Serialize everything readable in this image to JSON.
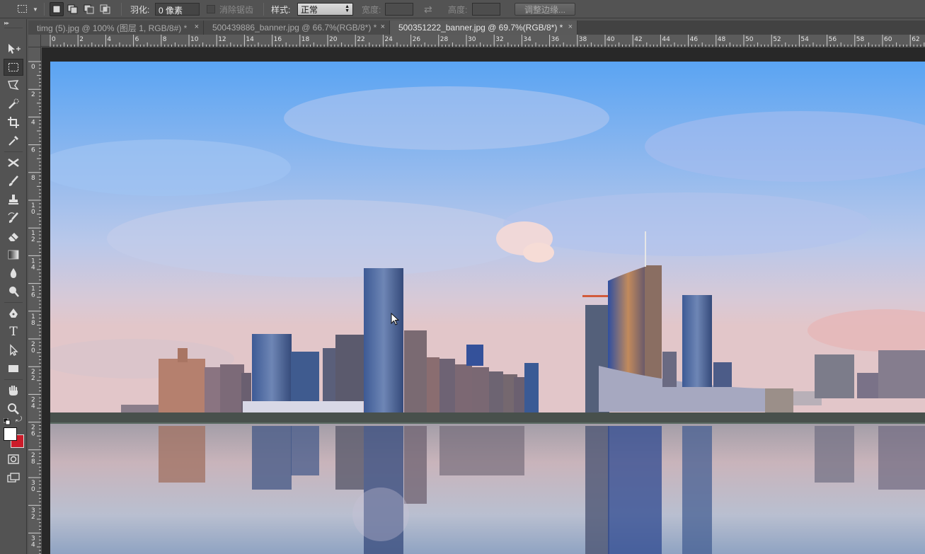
{
  "options_bar": {
    "feather_label": "羽化:",
    "feather_value": "0 像素",
    "antialias_label": "消除锯齿",
    "style_label": "样式:",
    "style_value": "正常",
    "width_label": "宽度:",
    "height_label": "高度:",
    "refine_edge_button": "调整边缘..."
  },
  "tabs": [
    {
      "label": "timg (5).jpg @ 100% (图层 1, RGB/8#) *",
      "active": false
    },
    {
      "label": "500439886_banner.jpg @ 66.7%(RGB/8*) *",
      "active": false
    },
    {
      "label": "500351222_banner.jpg @ 69.7%(RGB/8*) *",
      "active": true
    }
  ],
  "tools": [
    {
      "name": "move-tool",
      "icon": "move-icon"
    },
    {
      "name": "rect-marquee-tool",
      "icon": "rect-marquee-icon",
      "active": true
    },
    {
      "name": "lasso-tool",
      "icon": "polygonal-lasso-icon"
    },
    {
      "name": "quick-select-tool",
      "icon": "quick-select-icon"
    },
    {
      "name": "crop-tool",
      "icon": "crop-icon"
    },
    {
      "name": "eyedropper-tool",
      "icon": "eyedropper-icon"
    },
    {
      "name": "healing-tool",
      "icon": "healing-icon"
    },
    {
      "name": "brush-tool",
      "icon": "brush-icon"
    },
    {
      "name": "stamp-tool",
      "icon": "stamp-icon"
    },
    {
      "name": "history-brush-tool",
      "icon": "history-brush-icon"
    },
    {
      "name": "eraser-tool",
      "icon": "eraser-icon"
    },
    {
      "name": "gradient-tool",
      "icon": "gradient-icon"
    },
    {
      "name": "blur-tool",
      "icon": "drop-icon"
    },
    {
      "name": "dodge-tool",
      "icon": "dodge-icon"
    },
    {
      "name": "pen-tool",
      "icon": "pen-icon"
    },
    {
      "name": "type-tool",
      "icon": "type-icon"
    },
    {
      "name": "path-select-tool",
      "icon": "path-select-icon"
    },
    {
      "name": "rectangle-tool",
      "icon": "rectangle-icon"
    },
    {
      "name": "hand-tool",
      "icon": "hand-icon"
    },
    {
      "name": "zoom-tool",
      "icon": "zoom-icon"
    }
  ],
  "colors": {
    "foreground": "#ffffff",
    "background": "#cc1c2a"
  },
  "rulers": {
    "top_labels": [
      "0",
      "2",
      "4",
      "6",
      "8",
      "10",
      "12",
      "14",
      "16",
      "18",
      "20",
      "22",
      "24",
      "26",
      "28",
      "30",
      "32",
      "34",
      "36",
      "38",
      "40",
      "42",
      "44",
      "46",
      "48",
      "50",
      "52",
      "54",
      "56",
      "58",
      "60",
      "62"
    ],
    "left_labels": [
      "0",
      "2",
      "4",
      "6",
      "8",
      "10",
      "12",
      "14",
      "16",
      "18",
      "20",
      "22",
      "24",
      "26",
      "28",
      "30",
      "32",
      "34"
    ]
  },
  "canvas_image": {
    "description_icon": "city-skyline-image"
  }
}
